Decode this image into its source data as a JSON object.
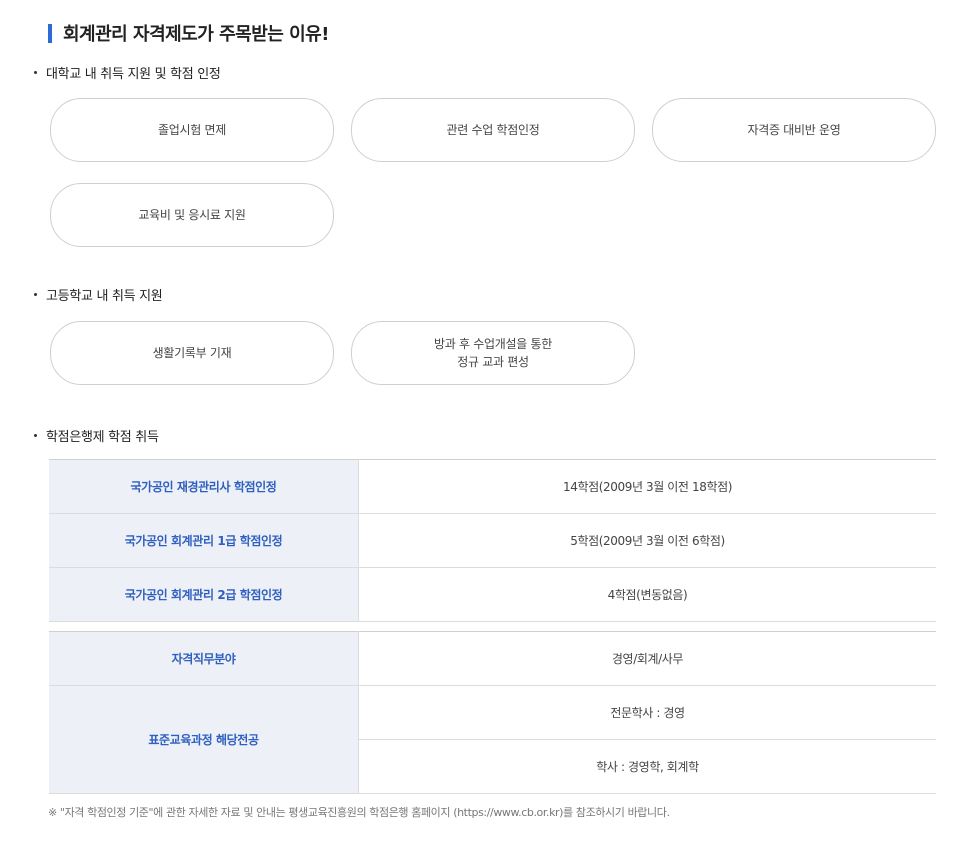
{
  "heading": "회계관리 자격제도가 주목받는 이유!",
  "sections": {
    "university": {
      "title": "대학교 내 취득 지원 및 학점 인정",
      "items": [
        "졸업시험 면제",
        "관련 수업 학점인정",
        "자격증 대비반 운영",
        "교육비 및 응시료 지원"
      ]
    },
    "highschool": {
      "title": "고등학교 내 취득 지원",
      "items": [
        "생활기록부 기재",
        "방과 후 수업개설을 통한",
        "정규 교과 편성"
      ]
    },
    "creditbank": {
      "title": "학점은행제 학점 취득"
    }
  },
  "credit_table": {
    "rows": [
      {
        "label": "국가공인 재경관리사 학점인정",
        "value": "14학점(2009년 3월 이전 18학점)"
      },
      {
        "label": "국가공인 회계관리 1급 학점인정",
        "value": "5학점(2009년 3월 이전 6학점)"
      },
      {
        "label": "국가공인 회계관리 2급 학점인정",
        "value": "4학점(변동없음)"
      }
    ]
  },
  "field_table": {
    "job_field_label": "자격직무분야",
    "job_field_value": "경영/회계/사무",
    "major_label": "표준교육과정 해당전공",
    "major_values": [
      "전문학사 : 경영",
      "학사 : 경영학, 회계학"
    ]
  },
  "note": "※ \"자격 학점인정 기준\"에 관한 자세한 자료 및 안내는 평생교육진흥원의 학점은행 홈페이지 (https://www.cb.or.kr)를 참조하시기 바랍니다.",
  "colors": {
    "accent": "#2f6bd8",
    "header_cell_bg": "#edf1f7",
    "header_cell_text": "#2f5fbf"
  }
}
